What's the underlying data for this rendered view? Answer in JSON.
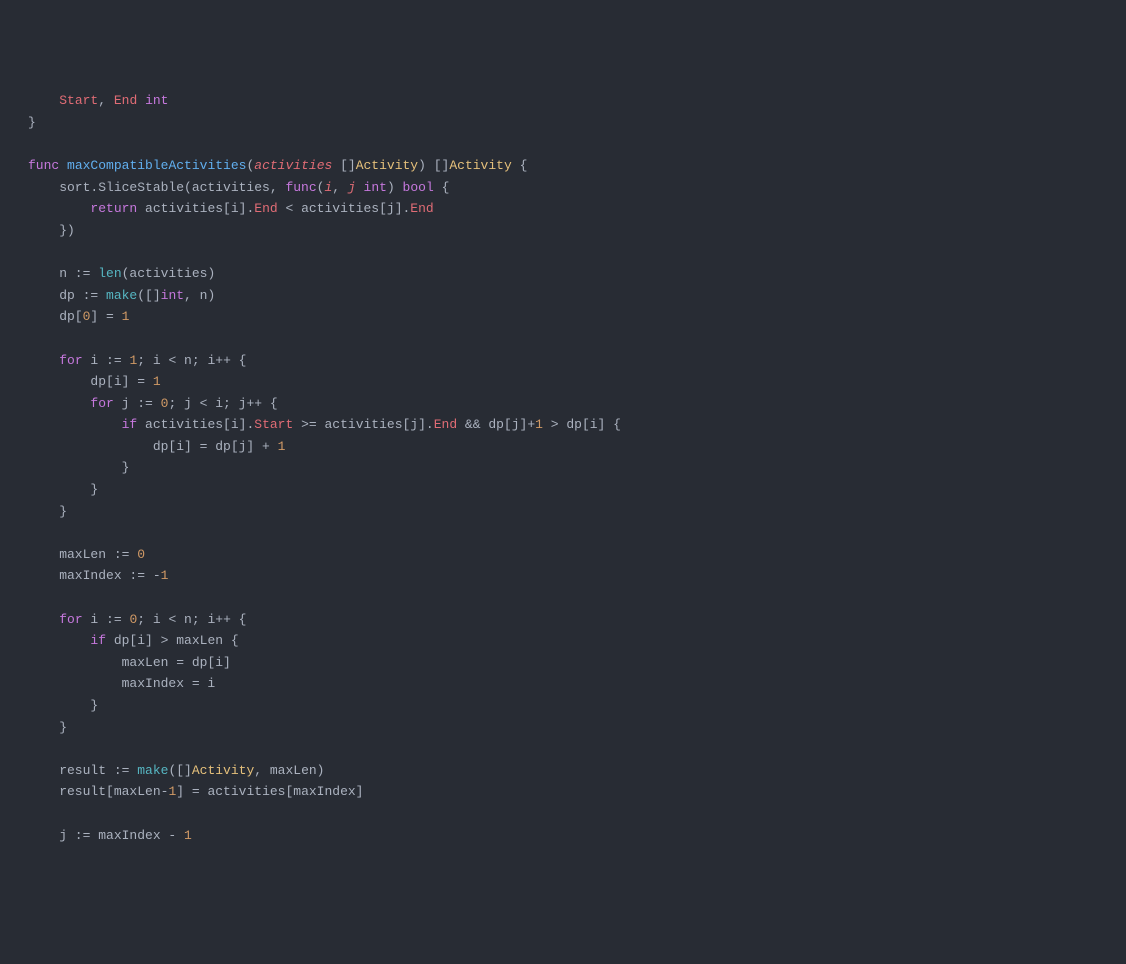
{
  "code": {
    "lines": [
      [
        {
          "cls": "ident",
          "t": "    "
        },
        {
          "cls": "decl",
          "t": "Start"
        },
        {
          "cls": "ident",
          "t": ", "
        },
        {
          "cls": "decl",
          "t": "End"
        },
        {
          "cls": "ident",
          "t": " "
        },
        {
          "cls": "typ",
          "t": "int"
        }
      ],
      [
        {
          "cls": "ident",
          "t": "}"
        }
      ],
      [],
      [
        {
          "cls": "kw",
          "t": "func"
        },
        {
          "cls": "ident",
          "t": " "
        },
        {
          "cls": "fn",
          "t": "maxCompatibleActivities"
        },
        {
          "cls": "ident",
          "t": "("
        },
        {
          "cls": "prm",
          "t": "activities"
        },
        {
          "cls": "ident",
          "t": " []"
        },
        {
          "cls": "etyp",
          "t": "Activity"
        },
        {
          "cls": "ident",
          "t": ") []"
        },
        {
          "cls": "etyp",
          "t": "Activity"
        },
        {
          "cls": "ident",
          "t": " {"
        }
      ],
      [
        {
          "cls": "ident",
          "t": "    sort.SliceStable(activities, "
        },
        {
          "cls": "kw",
          "t": "func"
        },
        {
          "cls": "ident",
          "t": "("
        },
        {
          "cls": "prm",
          "t": "i"
        },
        {
          "cls": "ident",
          "t": ", "
        },
        {
          "cls": "prm",
          "t": "j"
        },
        {
          "cls": "ident",
          "t": " "
        },
        {
          "cls": "typ",
          "t": "int"
        },
        {
          "cls": "ident",
          "t": ") "
        },
        {
          "cls": "typ",
          "t": "bool"
        },
        {
          "cls": "ident",
          "t": " {"
        }
      ],
      [
        {
          "cls": "ident",
          "t": "        "
        },
        {
          "cls": "kw",
          "t": "return"
        },
        {
          "cls": "ident",
          "t": " activities[i]."
        },
        {
          "cls": "prop",
          "t": "End"
        },
        {
          "cls": "ident",
          "t": " < activities[j]."
        },
        {
          "cls": "prop",
          "t": "End"
        }
      ],
      [
        {
          "cls": "ident",
          "t": "    })"
        }
      ],
      [],
      [
        {
          "cls": "ident",
          "t": "    n := "
        },
        {
          "cls": "bfn",
          "t": "len"
        },
        {
          "cls": "ident",
          "t": "(activities)"
        }
      ],
      [
        {
          "cls": "ident",
          "t": "    dp := "
        },
        {
          "cls": "bfn",
          "t": "make"
        },
        {
          "cls": "ident",
          "t": "([]"
        },
        {
          "cls": "typ",
          "t": "int"
        },
        {
          "cls": "ident",
          "t": ", n)"
        }
      ],
      [
        {
          "cls": "ident",
          "t": "    dp["
        },
        {
          "cls": "num",
          "t": "0"
        },
        {
          "cls": "ident",
          "t": "] = "
        },
        {
          "cls": "num",
          "t": "1"
        }
      ],
      [],
      [
        {
          "cls": "ident",
          "t": "    "
        },
        {
          "cls": "kw",
          "t": "for"
        },
        {
          "cls": "ident",
          "t": " i := "
        },
        {
          "cls": "num",
          "t": "1"
        },
        {
          "cls": "ident",
          "t": "; i < n; i++ {"
        }
      ],
      [
        {
          "cls": "ident",
          "t": "        dp[i] = "
        },
        {
          "cls": "num",
          "t": "1"
        }
      ],
      [
        {
          "cls": "ident",
          "t": "        "
        },
        {
          "cls": "kw",
          "t": "for"
        },
        {
          "cls": "ident",
          "t": " j := "
        },
        {
          "cls": "num",
          "t": "0"
        },
        {
          "cls": "ident",
          "t": "; j < i; j++ {"
        }
      ],
      [
        {
          "cls": "ident",
          "t": "            "
        },
        {
          "cls": "kw",
          "t": "if"
        },
        {
          "cls": "ident",
          "t": " activities[i]."
        },
        {
          "cls": "prop",
          "t": "Start"
        },
        {
          "cls": "ident",
          "t": " >= activities[j]."
        },
        {
          "cls": "prop",
          "t": "End"
        },
        {
          "cls": "ident",
          "t": " && dp[j]+"
        },
        {
          "cls": "num",
          "t": "1"
        },
        {
          "cls": "ident",
          "t": " > dp[i] {"
        }
      ],
      [
        {
          "cls": "ident",
          "t": "                dp[i] = dp[j] + "
        },
        {
          "cls": "num",
          "t": "1"
        }
      ],
      [
        {
          "cls": "ident",
          "t": "            }"
        }
      ],
      [
        {
          "cls": "ident",
          "t": "        }"
        }
      ],
      [
        {
          "cls": "ident",
          "t": "    }"
        }
      ],
      [],
      [
        {
          "cls": "ident",
          "t": "    maxLen := "
        },
        {
          "cls": "num",
          "t": "0"
        }
      ],
      [
        {
          "cls": "ident",
          "t": "    maxIndex := -"
        },
        {
          "cls": "num",
          "t": "1"
        }
      ],
      [],
      [
        {
          "cls": "ident",
          "t": "    "
        },
        {
          "cls": "kw",
          "t": "for"
        },
        {
          "cls": "ident",
          "t": " i := "
        },
        {
          "cls": "num",
          "t": "0"
        },
        {
          "cls": "ident",
          "t": "; i < n; i++ {"
        }
      ],
      [
        {
          "cls": "ident",
          "t": "        "
        },
        {
          "cls": "kw",
          "t": "if"
        },
        {
          "cls": "ident",
          "t": " dp[i] > maxLen {"
        }
      ],
      [
        {
          "cls": "ident",
          "t": "            maxLen = dp[i]"
        }
      ],
      [
        {
          "cls": "ident",
          "t": "            maxIndex = i"
        }
      ],
      [
        {
          "cls": "ident",
          "t": "        }"
        }
      ],
      [
        {
          "cls": "ident",
          "t": "    }"
        }
      ],
      [],
      [
        {
          "cls": "ident",
          "t": "    result := "
        },
        {
          "cls": "bfn",
          "t": "make"
        },
        {
          "cls": "ident",
          "t": "([]"
        },
        {
          "cls": "etyp",
          "t": "Activity"
        },
        {
          "cls": "ident",
          "t": ", maxLen)"
        }
      ],
      [
        {
          "cls": "ident",
          "t": "    result[maxLen-"
        },
        {
          "cls": "num",
          "t": "1"
        },
        {
          "cls": "ident",
          "t": "] = activities[maxIndex]"
        }
      ],
      [],
      [
        {
          "cls": "ident",
          "t": "    j := maxIndex - "
        },
        {
          "cls": "num",
          "t": "1"
        }
      ]
    ]
  }
}
